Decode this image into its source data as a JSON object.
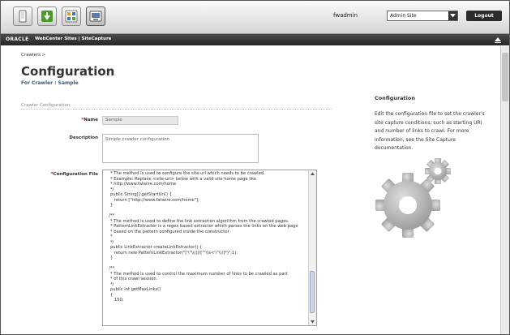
{
  "toolbar": {
    "username": "fwadmin",
    "site_selected": "Admin Site",
    "logout_label": "Logout"
  },
  "brand": {
    "logo": "ORACLE",
    "product": "WebCenter Sites | SiteCapture"
  },
  "breadcrumb": "Crawlers >",
  "page": {
    "title": "Configuration",
    "subtitle": "For Crawler : Sample"
  },
  "form": {
    "section_header": "Crawler Configuration",
    "name_label": "Name",
    "name_value": "Sample",
    "description_label": "Description",
    "description_value": "Simple crawler configuration",
    "config_label": "Configuration File",
    "config_lines": [
      "   * The method is used to configure the site url which needs to be crawled.",
      "   * Example: Replace <site-url> below with a valid site home page like",
      "   * http://www.fatwire.com/home",
      "   */",
      "   public String[] getStartUri() {",
      "      return [\"http://www.fatwire.com/home\"];",
      "   }",
      "",
      "  /**",
      "   * The method is used to define the link extraction algorithm from the crawled pages.",
      "   * PatternLinkExtractor is a regex based extractor which parses the links on the web page",
      "   * based on the pattern configured inside the constructor.",
      "   *",
      "   */",
      "   public LinkExtractor createLinkExtractor() {",
      "      return new PatternLinkExtractor(\"['\\\"\\\\(](/[^\\\\s<'\\\"\\\\)]*)\",1);",
      "   }",
      "",
      "  /**",
      "   * The method is used to control the maximum number of links to be crawled as part",
      "   * of this crawl session.",
      "   */",
      "   public int getMaxLinks()",
      "   {",
      "      150;"
    ]
  },
  "help": {
    "title": "Configuration",
    "text": "Edit the configuration file to set the crawler's site capture conditions, such as starting URI and number of links to crawl. For more information, see the Site Capture documentation."
  },
  "icons": {
    "tb1": "home-icon",
    "tb2": "download-icon",
    "tb3": "dashboard-icon",
    "tb4": "sitecapture-icon"
  }
}
